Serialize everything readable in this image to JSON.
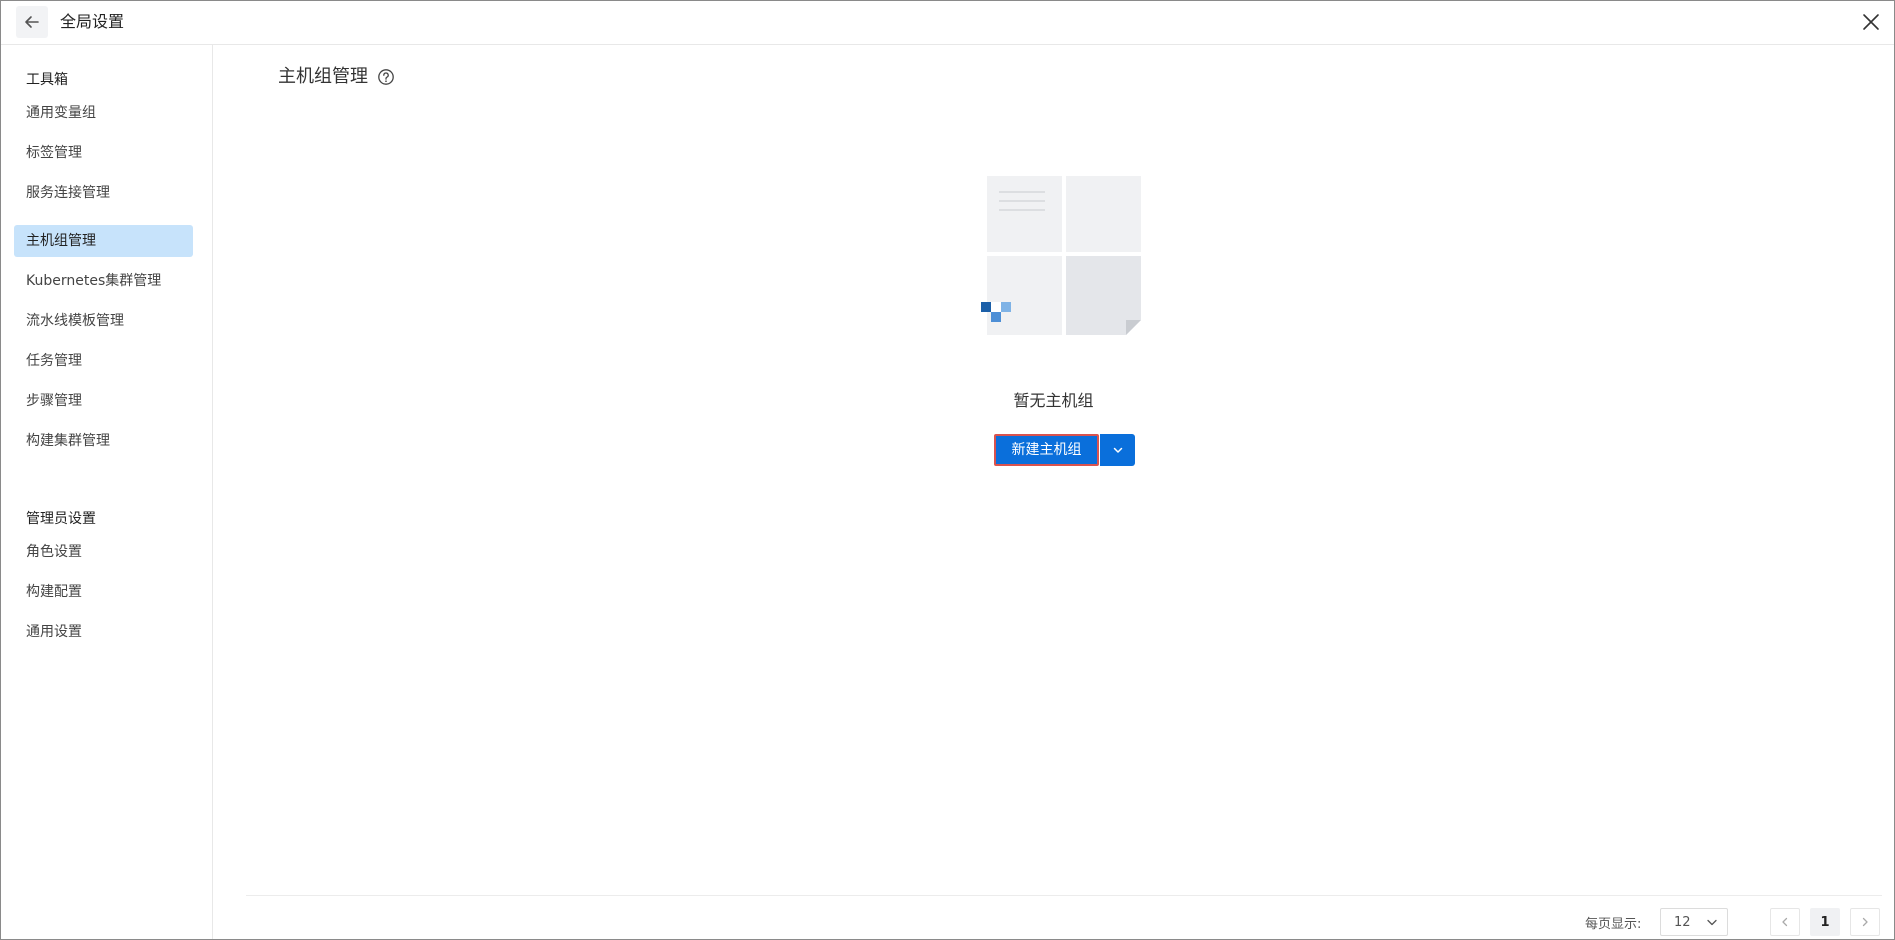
{
  "header": {
    "title": "全局设置",
    "back_icon": "arrow-left-icon",
    "close_icon": "close-icon"
  },
  "sidebar": {
    "toolbox_title": "工具箱",
    "toolbox_items": [
      {
        "label": "通用变量组"
      },
      {
        "label": "标签管理"
      },
      {
        "label": "服务连接管理"
      },
      {
        "label": "主机组管理",
        "active": true
      },
      {
        "label": "Kubernetes集群管理"
      },
      {
        "label": "流水线模板管理"
      },
      {
        "label": "任务管理"
      },
      {
        "label": "步骤管理"
      },
      {
        "label": "构建集群管理"
      }
    ],
    "admin_title": "管理员设置",
    "admin_items": [
      {
        "label": "角色设置"
      },
      {
        "label": "构建配置"
      },
      {
        "label": "通用设置"
      }
    ]
  },
  "main": {
    "title": "主机组管理",
    "help_icon": "question-circle-icon",
    "empty_text": "暂无主机组",
    "create_button": "新建主机组",
    "dropdown_icon": "chevron-down-icon"
  },
  "pagination": {
    "page_size_label": "每页显示:",
    "page_size": "12",
    "current_page": "1"
  },
  "colors": {
    "primary": "#0a6fdb",
    "active_nav_bg": "#c7e3fb",
    "highlight_border": "#d9534f"
  }
}
